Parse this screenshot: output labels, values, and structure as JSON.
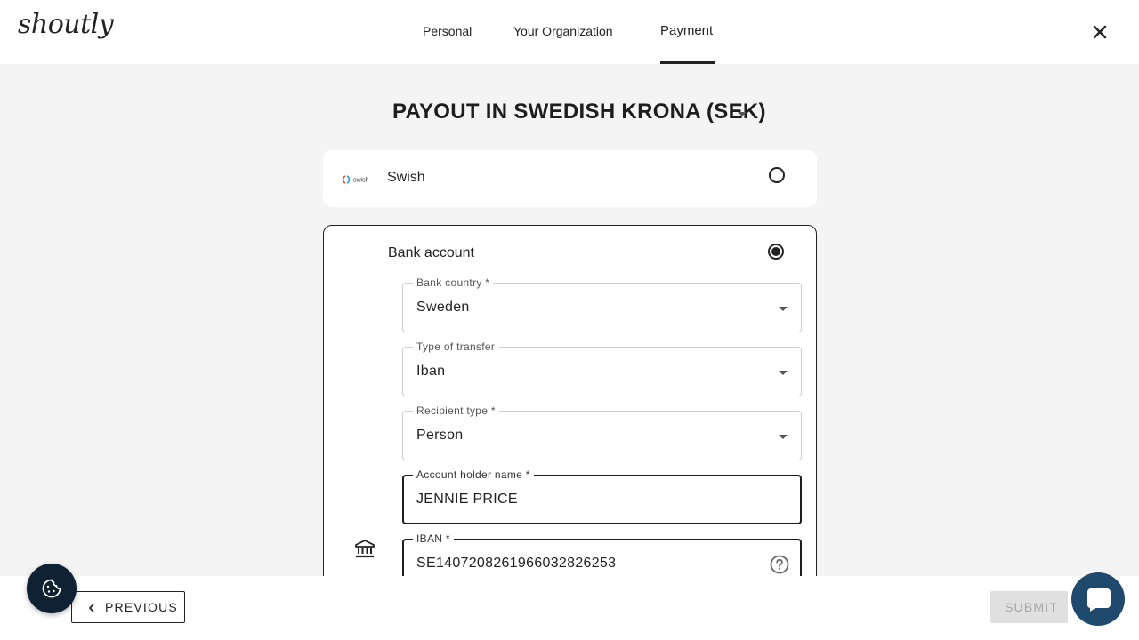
{
  "brand": {
    "logo_text": "shoutly"
  },
  "nav": {
    "tabs": [
      {
        "label": "Personal",
        "active": false
      },
      {
        "label": "Your Organization",
        "active": false
      },
      {
        "label": "Payment",
        "active": true
      }
    ]
  },
  "payout": {
    "title": "PAYOUT IN SWEDISH KRONA (SEK)",
    "options": {
      "swish": {
        "label": "Swish",
        "logo_text": "swish",
        "selected": false
      },
      "bank": {
        "label": "Bank account",
        "selected": true
      }
    },
    "fields": {
      "bank_country": {
        "label": "Bank country",
        "required_mark": " *",
        "value": "Sweden"
      },
      "transfer_type": {
        "label": "Type of transfer",
        "value": "Iban"
      },
      "recipient_type": {
        "label": "Recipient type",
        "required_mark": " *",
        "value": "Person"
      },
      "account_holder": {
        "label": "Account holder name",
        "required_mark": " *",
        "value": "JENNIE PRICE"
      },
      "iban": {
        "label": "IBAN",
        "required_mark": " *",
        "value": "SE1407208261966032826253"
      }
    }
  },
  "footer": {
    "previous_label": "PREVIOUS",
    "submit_label": "SUBMIT"
  },
  "icons": {
    "close": "close-icon",
    "bank": "bank-icon",
    "help": "help-icon",
    "cookie": "cookie-icon",
    "chat": "chat-icon"
  },
  "colors": {
    "accent": "#222222",
    "background": "#f4f4f4",
    "cookie_button": "#0e2233",
    "chat_button": "#1f4a6e",
    "disabled": "#e0e0e0"
  }
}
